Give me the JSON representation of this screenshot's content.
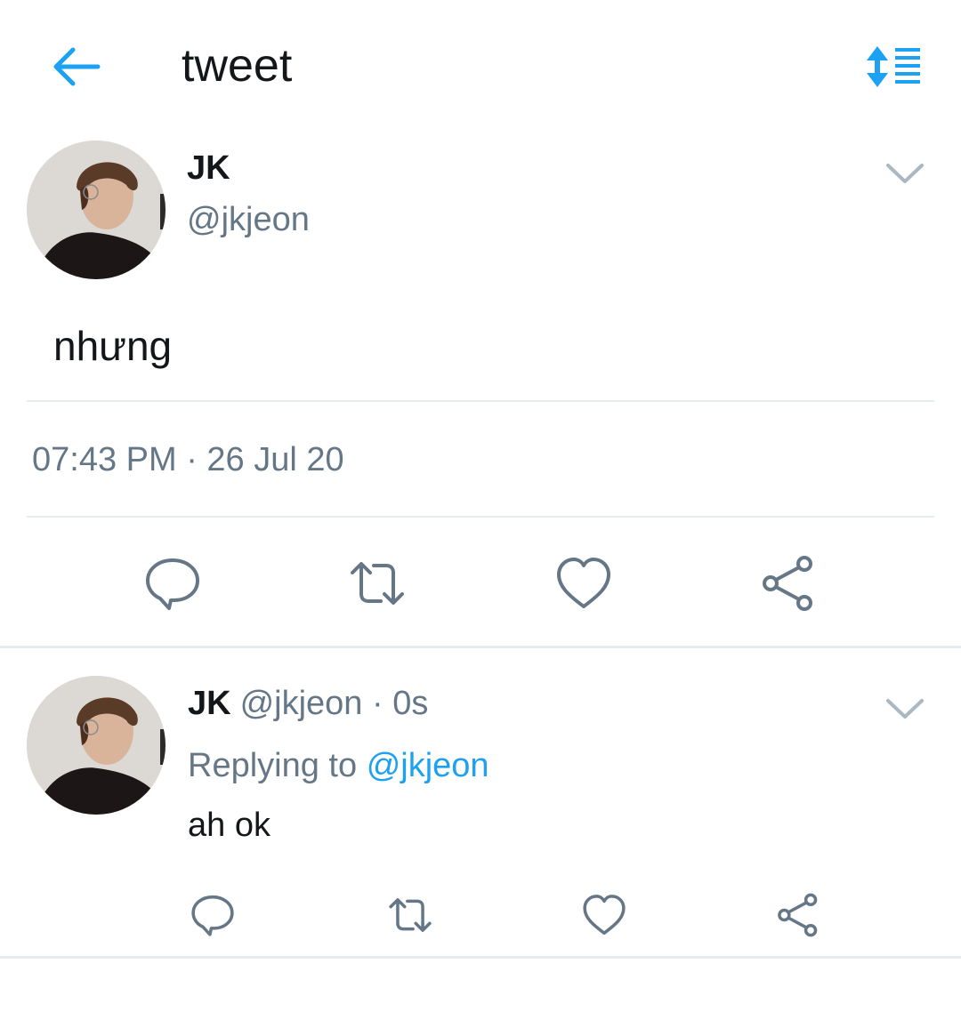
{
  "header": {
    "title": "tweet",
    "back_icon": "arrow-left-icon",
    "sort_icon": "sort-order-icon",
    "accent_color": "#1da1f2"
  },
  "tweet": {
    "name": "JK",
    "handle": "@jkjeon",
    "text": "nhưng",
    "timestamp": "07:43 PM · 26 Jul 20",
    "menu_icon": "chevron-down-icon"
  },
  "actions": [
    "reply-icon",
    "retweet-icon",
    "like-icon",
    "share-icon"
  ],
  "reply": {
    "name": "JK",
    "handle": "@jkjeon",
    "separator": "·",
    "time": "0s",
    "replying_label": "Replying to",
    "replying_to": "@jkjeon",
    "text": "ah ok"
  },
  "colors": {
    "text": "#14171a",
    "secondary": "#657786",
    "divider": "#e6ecf0"
  }
}
